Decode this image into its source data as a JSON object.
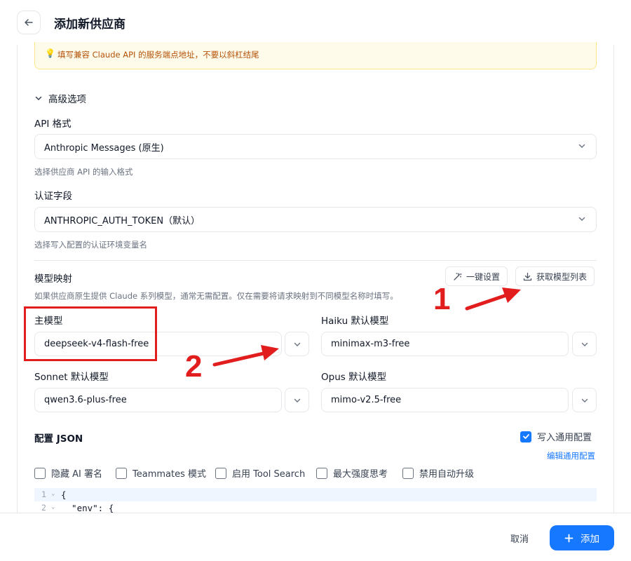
{
  "header": {
    "title": "添加新供应商"
  },
  "hint": {
    "text": "填写兼容 Claude API 的服务端点地址，不要以斜杠结尾"
  },
  "advanced": {
    "label": "高级选项"
  },
  "api_format": {
    "label": "API 格式",
    "value": "Anthropic Messages (原生)",
    "helper": "选择供应商 API 的输入格式"
  },
  "auth_field": {
    "label": "认证字段",
    "value": "ANTHROPIC_AUTH_TOKEN（默认）",
    "helper": "选择写入配置的认证环境变量名"
  },
  "model_mapping": {
    "title": "模型映射",
    "helper": "如果供应商原生提供 Claude 系列模型，通常无需配置。仅在需要将请求映射到不同模型名称时填写。",
    "one_click_label": "一键设置",
    "fetch_label": "获取模型列表",
    "main": {
      "label": "主模型",
      "value": "deepseek-v4-flash-free"
    },
    "haiku": {
      "label": "Haiku 默认模型",
      "value": "minimax-m3-free"
    },
    "sonnet": {
      "label": "Sonnet 默认模型",
      "value": "qwen3.6-plus-free"
    },
    "opus": {
      "label": "Opus 默认模型",
      "value": "mimo-v2.5-free"
    }
  },
  "annotations": {
    "num1": "1",
    "num2": "2"
  },
  "json_config": {
    "title": "配置 JSON",
    "write_common_label": "写入通用配置",
    "edit_common_link": "编辑通用配置",
    "options": [
      {
        "label": "隐藏 AI 署名"
      },
      {
        "label": "Teammates 模式"
      },
      {
        "label": "启用 Tool Search"
      },
      {
        "label": "最大强度思考"
      },
      {
        "label": "禁用自动升级"
      }
    ],
    "code_lines": [
      {
        "num": "1",
        "text": "{"
      },
      {
        "num": "2",
        "text": "  \"env\": {"
      }
    ]
  },
  "footer": {
    "cancel_label": "取消",
    "add_label": "添加"
  },
  "colors": {
    "accent": "#1677ff",
    "annotation_red": "#e11d1d",
    "hint_bg": "#fffbeb"
  }
}
